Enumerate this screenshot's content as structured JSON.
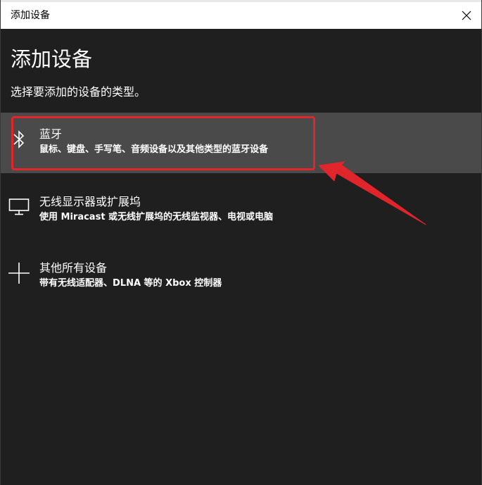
{
  "window": {
    "title": "添加设备"
  },
  "page": {
    "title": "添加设备",
    "subtitle": "选择要添加的设备的类型。"
  },
  "options": [
    {
      "name": "蓝牙",
      "description": "鼠标、键盘、手写笔、音频设备以及其他类型的蓝牙设备",
      "icon": "bluetooth-icon",
      "selected": true
    },
    {
      "name": "无线显示器或扩展坞",
      "description": "使用 Miracast 或无线扩展坞的无线监视器、电视或电脑",
      "icon": "monitor-icon",
      "selected": false
    },
    {
      "name": "其他所有设备",
      "description": "带有无线适配器、DLNA 等的 Xbox 控制器",
      "icon": "plus-icon",
      "selected": false
    }
  ],
  "annotation": {
    "color": "#e0252b"
  }
}
